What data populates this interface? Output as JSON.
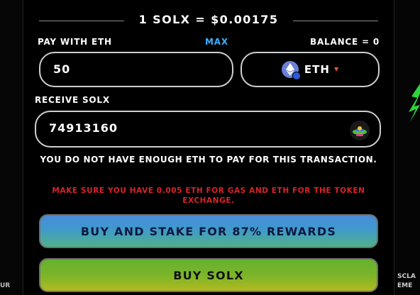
{
  "rate": "1 SOLX = $0.00175",
  "pay": {
    "label": "PAY WITH ETH",
    "max_label": "MAX",
    "balance": "BALANCE = 0",
    "value": "50",
    "token": "ETH"
  },
  "receive": {
    "label": "RECEIVE SOLX",
    "value": "74913160"
  },
  "warning": "YOU DO NOT HAVE ENOUGH ETH TO PAY FOR THIS TRANSACTION.",
  "gas_note": "MAKE SURE YOU HAVE 0.005 ETH FOR GAS AND ETH FOR THE TOKEN EXCHANGE.",
  "buttons": {
    "stake": "BUY AND STAKE FOR 87% REWARDS",
    "buy": "BUY SOLX"
  },
  "side": {
    "left_text": "UR",
    "right_text_1": "SCLA",
    "right_text_2": "EME"
  },
  "colors": {
    "accent_blue": "#3ab0ff",
    "warning_red": "#d8242a"
  }
}
